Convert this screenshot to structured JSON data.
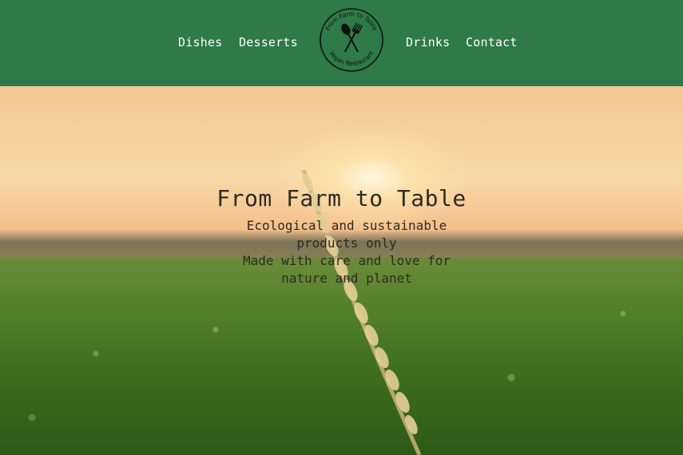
{
  "nav": {
    "left": [
      "Dishes",
      "Desserts"
    ],
    "right": [
      "Drinks",
      "Contact"
    ]
  },
  "logo": {
    "top_text": "From Farm to Table",
    "bottom_text": "Vegan Restaurant",
    "icon": "fork-and-spoon-icon"
  },
  "hero": {
    "title": "From Farm to Table",
    "subtitle_1": "Ecological and sustainable products only",
    "subtitle_2": "Made with care and love for nature and planet"
  },
  "colors": {
    "nav_bg": "#2e7a48",
    "nav_text": "#ffffff",
    "hero_text": "#2d2a22"
  }
}
